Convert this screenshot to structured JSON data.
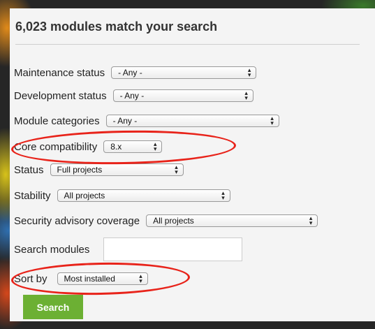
{
  "page": {
    "title": "6,023 modules match your search"
  },
  "filters": {
    "maintenance_status": {
      "label": "Maintenance status",
      "value": "- Any -"
    },
    "development_status": {
      "label": "Development status",
      "value": "- Any -"
    },
    "module_categories": {
      "label": "Module categories",
      "value": "- Any -"
    },
    "core_compatibility": {
      "label": "Core compatibility",
      "value": "8.x"
    },
    "status": {
      "label": "Status",
      "value": "Full projects"
    },
    "stability": {
      "label": "Stability",
      "value": "All projects"
    },
    "security_coverage": {
      "label": "Security advisory coverage",
      "value": "All projects"
    },
    "search_modules": {
      "label": "Search modules",
      "value": ""
    },
    "sort_by": {
      "label": "Sort by",
      "value": "Most installed"
    }
  },
  "actions": {
    "search_label": "Search"
  },
  "colors": {
    "search_button": "#6cb033",
    "annotation_circle": "#e8231a"
  },
  "icons": {
    "select_arrow": "up-down-chevron-icon"
  }
}
